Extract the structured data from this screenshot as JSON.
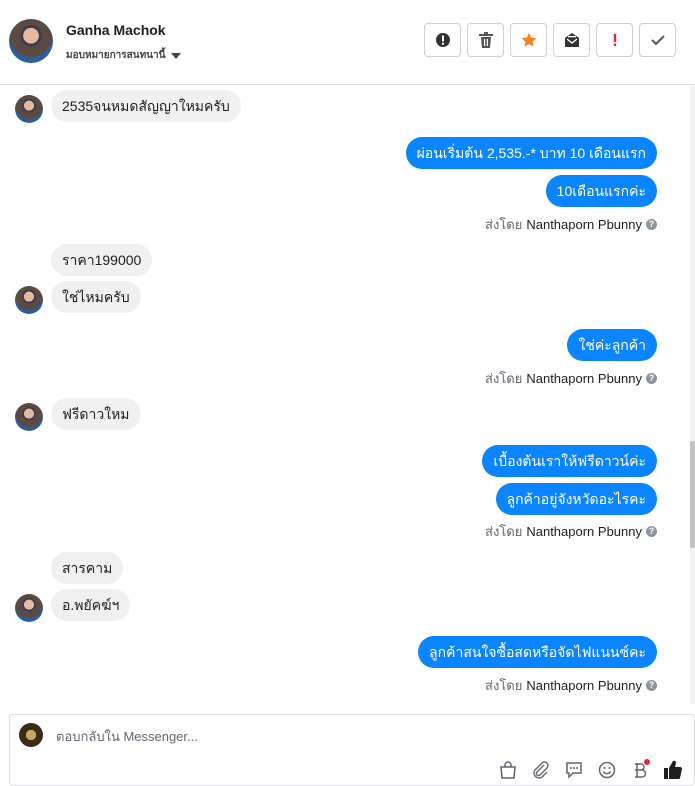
{
  "header": {
    "contact_name": "Ganha Machok",
    "assign_label": "มอบหมายการสนทนานี้",
    "actions": [
      {
        "name": "spam-icon",
        "color": "#333333"
      },
      {
        "name": "trash-icon",
        "color": "#555555"
      },
      {
        "name": "star-icon",
        "color": "#f5821f"
      },
      {
        "name": "mark-unread-icon",
        "color": "#333333"
      },
      {
        "name": "important-icon",
        "color": "#e4233c"
      },
      {
        "name": "done-check-icon",
        "color": "#555555"
      }
    ]
  },
  "messages": [
    {
      "dir": "in",
      "text": "2535จนหมดสัญญาใหมครับ"
    },
    {
      "dir": "out",
      "text": "ผ่อนเริ่มต้น 2,535.-* บาท 10 เดือนแรก"
    },
    {
      "dir": "out",
      "text": "10เดือนแรกค่ะ"
    },
    {
      "dir": "in",
      "text": "ราคา199000"
    },
    {
      "dir": "in",
      "text": "ใช่ไหมครับ"
    },
    {
      "dir": "out",
      "text": "ใช่ค่ะลูกค้า"
    },
    {
      "dir": "in",
      "text": "ฟรีดาวใหม"
    },
    {
      "dir": "out",
      "text": "เบื้องต้นเราให้ฟรีดาวน์ค่ะ"
    },
    {
      "dir": "out",
      "text": "ลูกค้าอยู่จังหวัดอะไรคะ"
    },
    {
      "dir": "in",
      "text": "สารคาม"
    },
    {
      "dir": "in",
      "text": "อ.พยัคฆ์ฯ"
    },
    {
      "dir": "out",
      "text": "ลูกค้าสนใจซื้อสดหรือจัดไฟแนนซ์คะ"
    }
  ],
  "sent_by": {
    "prefix": "ส่งโดย",
    "name": "Nanthaporn Pbunny",
    "help": "?"
  },
  "composer": {
    "placeholder": "ตอบกลับใน Messenger...",
    "tools": [
      "bag-icon",
      "paperclip-icon",
      "saved-reply-icon",
      "emoji-icon",
      "baht-payment-icon",
      "like-thumb-icon"
    ],
    "accent": "#0b84ff"
  }
}
